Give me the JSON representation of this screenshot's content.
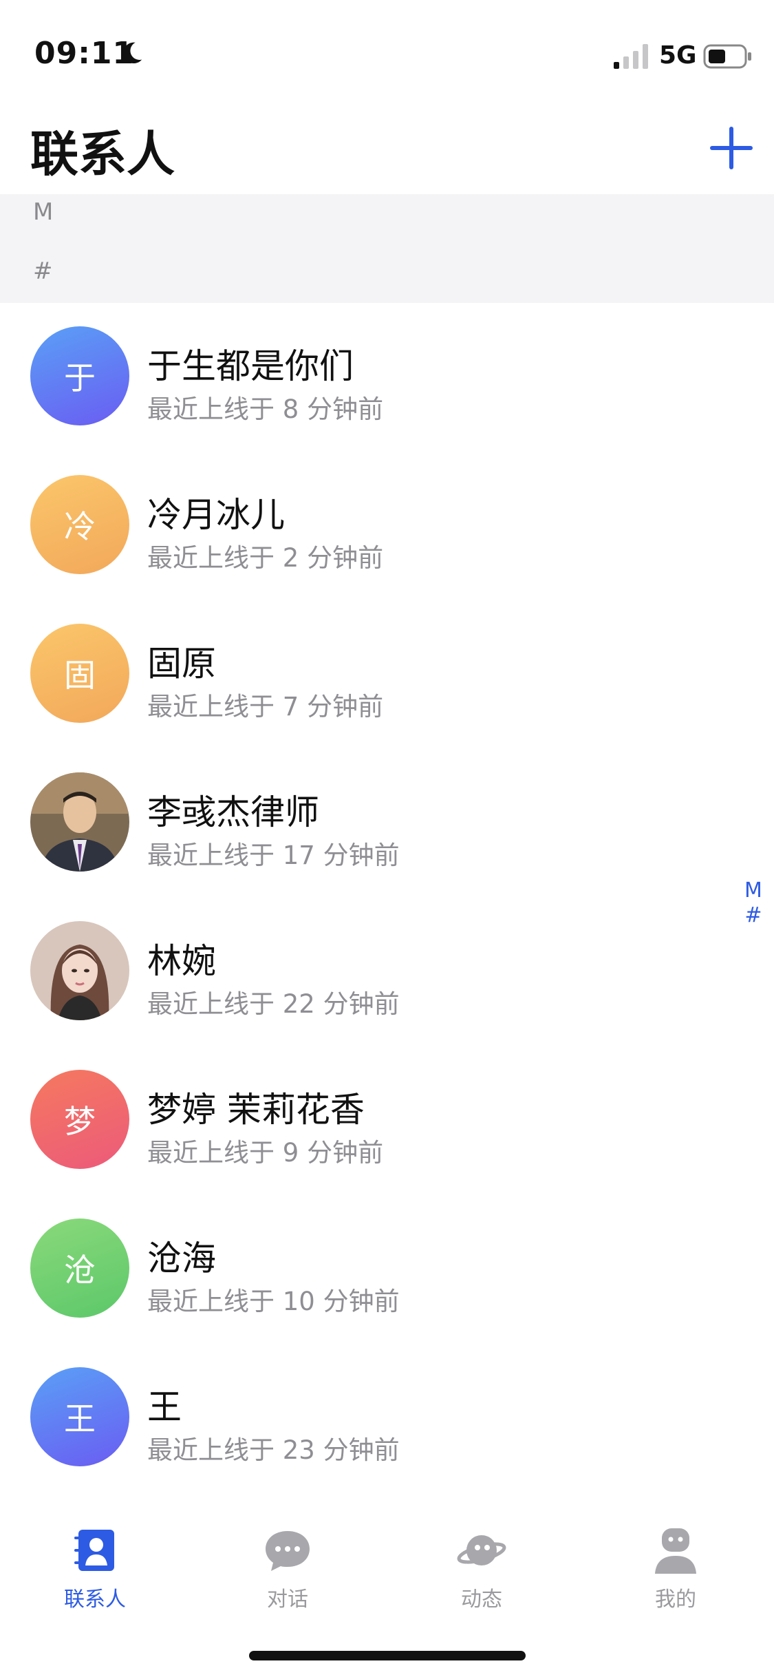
{
  "status_bar": {
    "time": "09:11",
    "network": "5G"
  },
  "header": {
    "title": "联系人"
  },
  "sections": [
    "M",
    "#"
  ],
  "contacts": [
    {
      "name": "于生都是你们",
      "status": "最近上线于 8 分钟前",
      "avatar_char": "于",
      "avatar_color": "#6a6ff2"
    },
    {
      "name": "冷月冰儿",
      "status": "最近上线于 2 分钟前",
      "avatar_char": "冷",
      "avatar_color": "#f6b862"
    },
    {
      "name": "固原",
      "status": "最近上线于 7 分钟前",
      "avatar_char": "固",
      "avatar_color": "#f6b862"
    },
    {
      "name": "李彧杰律师",
      "status": "最近上线于 17 分钟前",
      "avatar_char": "",
      "avatar_color": "#6b5a45"
    },
    {
      "name": "林婉",
      "status": "最近上线于 22 分钟前",
      "avatar_char": "",
      "avatar_color": "#c9b3a8"
    },
    {
      "name": "梦婷 茉莉花香",
      "status": "最近上线于 9 分钟前",
      "avatar_char": "梦",
      "avatar_color": "#ef6a66"
    },
    {
      "name": "沧海",
      "status": "最近上线于 10 分钟前",
      "avatar_char": "沧",
      "avatar_color": "#74d06e"
    },
    {
      "name": "王",
      "status": "最近上线于 23 分钟前",
      "avatar_char": "王",
      "avatar_color": "#6a6ff2"
    }
  ],
  "side_index": [
    "M",
    "#"
  ],
  "tabs": [
    {
      "label": "联系人",
      "icon": "contacts-icon",
      "active": true
    },
    {
      "label": "对话",
      "icon": "chat-icon",
      "active": false
    },
    {
      "label": "动态",
      "icon": "planet-icon",
      "active": false
    },
    {
      "label": "我的",
      "icon": "profile-icon",
      "active": false
    }
  ],
  "colors": {
    "accent": "#2d5be3",
    "band": "#f4f4f6",
    "secondary_text": "#8e8e93"
  }
}
